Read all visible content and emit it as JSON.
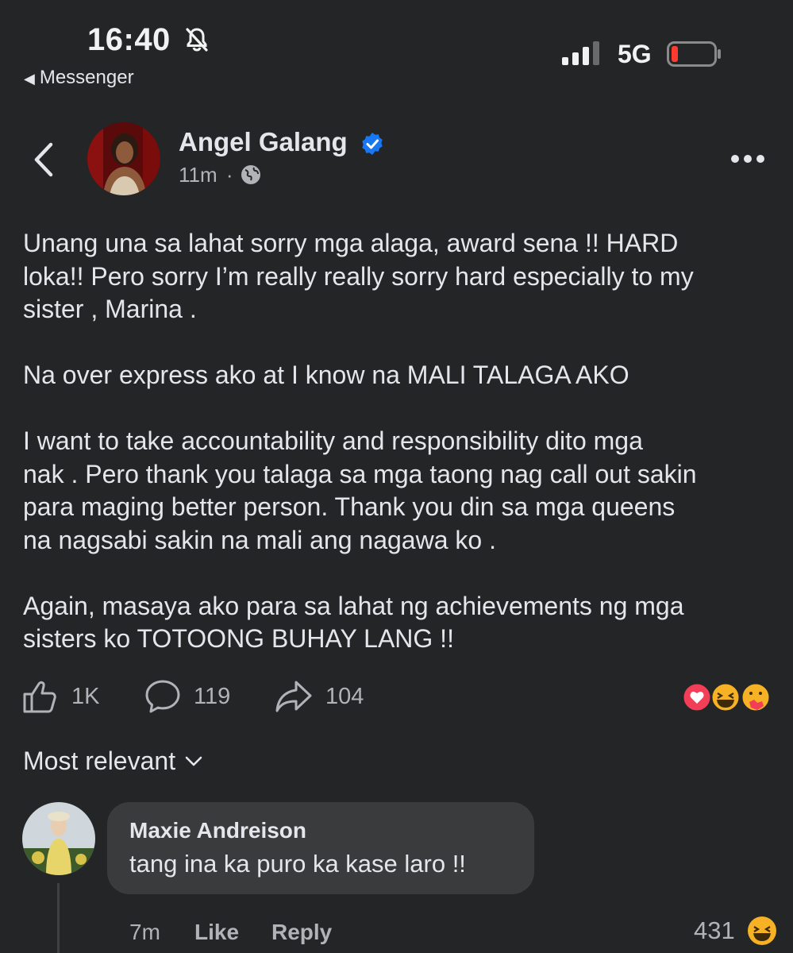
{
  "status_bar": {
    "time": "16:40",
    "back_app": "Messenger",
    "network": "5G"
  },
  "post": {
    "author": "Angel Galang",
    "time_ago": "11m",
    "privacy_separator": "·",
    "paragraphs": [
      "Unang una sa lahat sorry mga alaga, award sena !! HARD\nloka!! Pero sorry I’m really really sorry hard especially to my\nsister , Marina .",
      "Na over express ako at I know na MALI TALAGA AKO",
      "I want to take accountability and responsibility dito mga\nnak . Pero thank you talaga sa mga taong nag call out sakin\npara maging better person. Thank you din sa mga queens\nna nagsabi sakin na mali ang nagawa ko .",
      "Again, masaya ako para sa lahat ng achievements ng mga\nsisters ko TOTOONG BUHAY LANG !!"
    ],
    "likes": "1K",
    "comments": "119",
    "shares": "104",
    "reaction_icons": [
      "heart-icon",
      "laugh-emoji-icon",
      "care-emoji-icon"
    ]
  },
  "comments_section": {
    "sort_label": "Most relevant",
    "comments": [
      {
        "author": "Maxie Andreison",
        "text": "tang ina ka puro ka kase laro !!",
        "time": "7m",
        "like_label": "Like",
        "reply_label": "Reply",
        "reaction_count": "431",
        "reaction_icon": "laugh-emoji-icon"
      }
    ]
  },
  "colors": {
    "background": "#242526",
    "text_primary": "#e4e6eb",
    "text_secondary": "#b0b3b8",
    "verified_blue": "#1877f2",
    "bubble": "#3a3b3c",
    "battery_low": "#ff3b30"
  }
}
